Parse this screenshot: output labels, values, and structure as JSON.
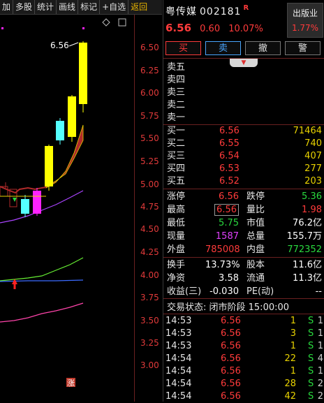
{
  "toolbar": {
    "items": [
      "加",
      "多股",
      "统计",
      "画线",
      "标记",
      "+自选",
      "返回"
    ]
  },
  "chart": {
    "peak_label": "6.56",
    "marker": "涨",
    "y_ticks": [
      "6.50",
      "6.25",
      "6.00",
      "5.75",
      "5.50",
      "5.25",
      "5.00",
      "4.75",
      "4.50",
      "4.25",
      "4.00",
      "3.75",
      "3.50",
      "3.25",
      "3.00"
    ],
    "colors": {
      "up": "#ffff00",
      "down": "#55ffff",
      "magenta": "#ff22ff",
      "band": "#b02a2a",
      "ma_green": "#66ee33",
      "ma_blue": "#3b6bff",
      "ma_purple": "#aa44ff",
      "ma_pink": "#ff44aa",
      "tick": "#e13a3a"
    }
  },
  "quote": {
    "name": "粤传媒",
    "code": "002181",
    "r_mark": "R",
    "price": "6.56",
    "change": "0.60",
    "change_pct": "10.07%",
    "sector": {
      "name": "出版业",
      "pct": "1.77%"
    }
  },
  "buttons": {
    "buy": "买",
    "sell": "卖",
    "cancel": "撤",
    "alert": "警"
  },
  "asks": [
    {
      "label": "卖五"
    },
    {
      "label": "卖四"
    },
    {
      "label": "卖三"
    },
    {
      "label": "卖二"
    },
    {
      "label": "卖一"
    }
  ],
  "bids": [
    {
      "label": "买一",
      "price": "6.56",
      "volume": "71464"
    },
    {
      "label": "买二",
      "price": "6.55",
      "volume": "740"
    },
    {
      "label": "买三",
      "price": "6.54",
      "volume": "407"
    },
    {
      "label": "买四",
      "price": "6.53",
      "volume": "277"
    },
    {
      "label": "买五",
      "price": "6.52",
      "volume": "203"
    }
  ],
  "stats": [
    {
      "l1": "涨停",
      "v1": "6.56",
      "l2": "跌停",
      "v2": "5.36"
    },
    {
      "l1": "最高",
      "v1": "6.56",
      "l2": "量比",
      "v2": "1.98"
    },
    {
      "l1": "最低",
      "v1": "5.75",
      "l2": "市值",
      "v2": "76.2亿"
    },
    {
      "l1": "现量",
      "v1": "1587",
      "l2": "总量",
      "v2": "155.7万"
    },
    {
      "l1": "外盘",
      "v1": "785008",
      "l2": "内盘",
      "v2": "772352"
    },
    {
      "l1": "换手",
      "v1": "13.73%",
      "l2": "股本",
      "v2": "11.6亿"
    },
    {
      "l1": "净资",
      "v1": "3.58",
      "l2": "流通",
      "v2": "11.3亿"
    },
    {
      "l1": "收益(三)",
      "v1": "-0.030",
      "l2": "PE(动)",
      "v2": "--"
    }
  ],
  "trade_status": "交易状态: 闭市阶段 15:00:00",
  "trades": [
    {
      "time": "14:53",
      "price": "6.56",
      "volume": "1",
      "side": "S",
      "count": "1"
    },
    {
      "time": "14:53",
      "price": "6.56",
      "volume": "3",
      "side": "S",
      "count": "1"
    },
    {
      "time": "14:53",
      "price": "6.56",
      "volume": "1",
      "side": "S",
      "count": "1"
    },
    {
      "time": "14:54",
      "price": "6.56",
      "volume": "22",
      "side": "S",
      "count": "4"
    },
    {
      "time": "14:54",
      "price": "6.56",
      "volume": "1",
      "side": "S",
      "count": "1"
    },
    {
      "time": "14:54",
      "price": "6.56",
      "volume": "28",
      "side": "S",
      "count": "2"
    },
    {
      "time": "14:54",
      "price": "6.56",
      "volume": "42",
      "side": "S",
      "count": "2"
    }
  ]
}
